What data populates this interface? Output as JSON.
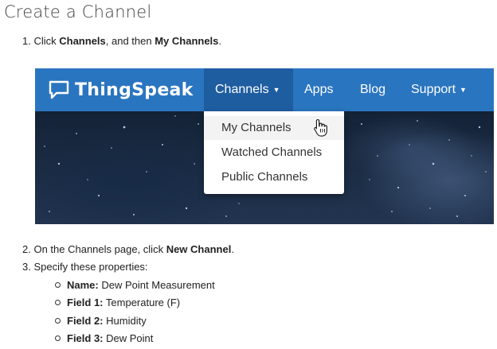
{
  "page": {
    "title": "Create a Channel"
  },
  "steps": [
    {
      "num": "1.",
      "pre": "Click ",
      "b1": "Channels",
      "mid": ", and then ",
      "b2": "My Channels",
      "post": "."
    },
    {
      "num": "2.",
      "pre": "On the Channels page, click ",
      "b1": "New Channel",
      "post": "."
    },
    {
      "num": "3.",
      "text": "Specify these properties:"
    }
  ],
  "properties": [
    {
      "label": "Name:",
      "value": "Dew Point Measurement"
    },
    {
      "label": "Field 1:",
      "value": "Temperature (F)"
    },
    {
      "label": "Field 2:",
      "value": "Humidity"
    },
    {
      "label": "Field 3:",
      "value": "Dew Point"
    }
  ],
  "screenshot": {
    "brand": "ThingSpeak",
    "nav": {
      "channels": "Channels",
      "apps": "Apps",
      "blog": "Blog",
      "support": "Support"
    },
    "dropdown": [
      "My Channels",
      "Watched Channels",
      "Public Channels"
    ]
  },
  "colors": {
    "navbar": "#2a75c0",
    "navbar_active": "#1e5da0"
  }
}
